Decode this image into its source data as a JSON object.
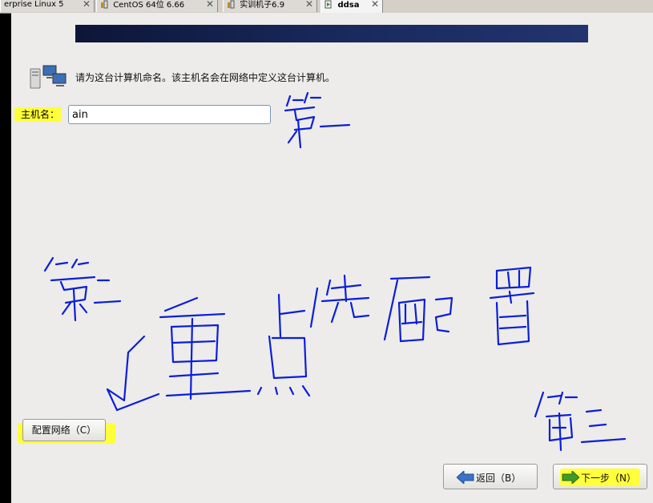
{
  "tabs": [
    {
      "label": "erprise Linux 5",
      "close": "✕"
    },
    {
      "label": "CentOS 64位 6.66",
      "close": "✕"
    },
    {
      "label": "实训机子6.9",
      "close": "✕"
    },
    {
      "label": "ddsa",
      "close": "✕"
    }
  ],
  "intro": {
    "icon": "network-computers-icon",
    "text": "请为这台计算机命名。该主机名会在网络中定义这台计算机。"
  },
  "hostname": {
    "label": "主机名：",
    "value": "ain"
  },
  "buttons": {
    "configure_network": "配置网络（C）",
    "back": "返回（B）",
    "next": "下一步（N）"
  },
  "annotations": {
    "color": "#0a1edc",
    "highlight_color": "#ffff3a",
    "notes": [
      "第一",
      "第二",
      "重点",
      "先配置",
      "第三"
    ]
  }
}
